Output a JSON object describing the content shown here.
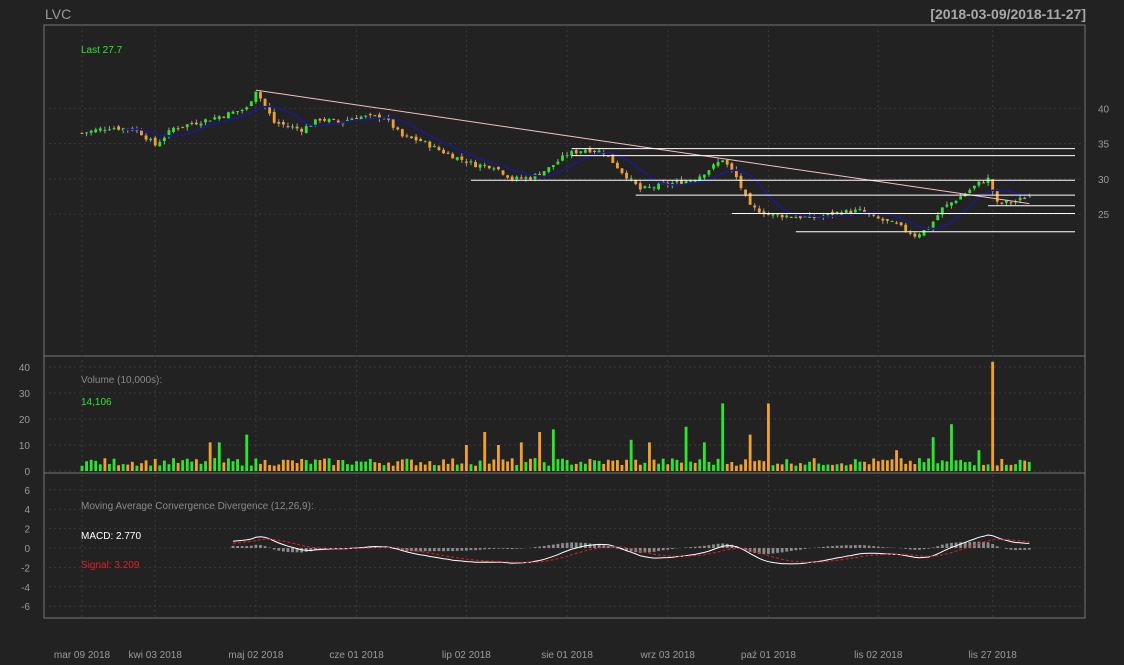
{
  "header": {
    "ticker": "LVC",
    "range": "[2018-03-09/2018-11-27]"
  },
  "colors": {
    "up": "#2ee52e",
    "down": "#f0a030",
    "ma": "#1a1a8c",
    "trendline": "#f4c0c0",
    "macd": "#ffffff",
    "signal": "#e02020",
    "hist": "#8a8a8a",
    "bg": "#222222",
    "panel_border": "#777777",
    "grid": "#3a3a3a"
  },
  "panels": {
    "price": {
      "last_label": "Last 27.7"
    },
    "volume": {
      "title": "Volume (10,000s):",
      "last_value": "14,106"
    },
    "macd": {
      "title": "Moving Average Convergence Divergence (12,26,9):",
      "macd_label": "MACD: 2.770",
      "signal_label": "Signal: 3.209"
    }
  },
  "chart_data": [
    {
      "type": "candlestick",
      "ticker": "LVC",
      "date_range": "2018-03-09/2018-11-27",
      "x_ticks": [
        "mar 09 2018",
        "kwi 03 2018",
        "maj 02 2018",
        "cze 01 2018",
        "lip 02 2018",
        "sie 01 2018",
        "wrz 03 2018",
        "paź 01 2018",
        "lis 02 2018",
        "lis 27 2018"
      ],
      "y_ticks": [
        25,
        30,
        35,
        40
      ],
      "ylim": [
        20.5,
        43.5
      ],
      "close_path": [
        [
          0,
          36.5
        ],
        [
          6,
          37.3
        ],
        [
          12,
          37.0
        ],
        [
          16,
          34.8
        ],
        [
          20,
          37.2
        ],
        [
          28,
          38.5
        ],
        [
          36,
          40.0
        ],
        [
          38,
          42.6
        ],
        [
          42,
          38.0
        ],
        [
          48,
          37.0
        ],
        [
          52,
          38.5
        ],
        [
          56,
          38.0
        ],
        [
          60,
          38.8
        ],
        [
          66,
          38.8
        ],
        [
          70,
          36.0
        ],
        [
          74,
          35.4
        ],
        [
          80,
          33.5
        ],
        [
          86,
          32.0
        ],
        [
          90,
          31.8
        ],
        [
          94,
          30.0
        ],
        [
          98,
          30.2
        ],
        [
          102,
          31.5
        ],
        [
          106,
          33.5
        ],
        [
          110,
          34.2
        ],
        [
          114,
          33.8
        ],
        [
          118,
          31.0
        ],
        [
          122,
          28.5
        ],
        [
          126,
          29.0
        ],
        [
          130,
          29.5
        ],
        [
          134,
          30.0
        ],
        [
          138,
          31.8
        ],
        [
          140,
          32.8
        ],
        [
          143,
          30.2
        ],
        [
          146,
          26.0
        ],
        [
          150,
          25.0
        ],
        [
          155,
          24.7
        ],
        [
          160,
          24.5
        ],
        [
          165,
          25.2
        ],
        [
          170,
          25.5
        ],
        [
          173,
          24.5
        ],
        [
          178,
          23.5
        ],
        [
          182,
          22.0
        ],
        [
          185,
          23.0
        ],
        [
          188,
          25.8
        ],
        [
          192,
          27.5
        ],
        [
          196,
          29.4
        ],
        [
          198,
          30.0
        ],
        [
          200,
          26.5
        ],
        [
          204,
          26.8
        ],
        [
          207,
          27.6
        ]
      ],
      "trendline_levels": [
        {
          "from_day": 38,
          "from_price": 42.6,
          "to_day": 207,
          "to_price": 26.5
        }
      ],
      "support_levels": [
        {
          "price": 34.3,
          "from_day": 107,
          "to_day": 210
        },
        {
          "price": 33.3,
          "from_day": 107,
          "to_day": 210
        },
        {
          "price": 29.8,
          "from_day": 85,
          "to_day": 210
        },
        {
          "price": 27.7,
          "from_day": 121,
          "to_day": 210
        },
        {
          "price": 26.2,
          "from_day": 198,
          "to_day": 210
        },
        {
          "price": 25.1,
          "from_day": 142,
          "to_day": 210
        },
        {
          "price": 22.5,
          "from_day": 156,
          "to_day": 210
        }
      ],
      "last": 27.7
    },
    {
      "type": "bar",
      "name": "Volume (10,000s)",
      "y_ticks": [
        0,
        10,
        20,
        30,
        40
      ],
      "ylim": [
        0,
        42
      ],
      "spikes": [
        {
          "day": 28,
          "value": 11
        },
        {
          "day": 30,
          "value": 11
        },
        {
          "day": 36,
          "value": 14
        },
        {
          "day": 84,
          "value": 10
        },
        {
          "day": 88,
          "value": 15
        },
        {
          "day": 91,
          "value": 10
        },
        {
          "day": 96,
          "value": 11
        },
        {
          "day": 100,
          "value": 15
        },
        {
          "day": 103,
          "value": 16
        },
        {
          "day": 120,
          "value": 12
        },
        {
          "day": 124,
          "value": 11
        },
        {
          "day": 132,
          "value": 17
        },
        {
          "day": 136,
          "value": 11
        },
        {
          "day": 140,
          "value": 26
        },
        {
          "day": 146,
          "value": 14
        },
        {
          "day": 150,
          "value": 26
        },
        {
          "day": 178,
          "value": 8
        },
        {
          "day": 186,
          "value": 13
        },
        {
          "day": 190,
          "value": 18
        },
        {
          "day": 196,
          "value": 8
        },
        {
          "day": 199,
          "value": 42
        }
      ],
      "base_volume": 2,
      "last": 14.106
    },
    {
      "type": "line",
      "name": "Moving Average Convergence Divergence (12,26,9)",
      "y_ticks": [
        -6,
        -4,
        -2,
        0,
        2,
        4,
        6
      ],
      "ylim": [
        -6.5,
        6.5
      ],
      "macd_last": 2.77,
      "signal_last": 3.209
    }
  ]
}
